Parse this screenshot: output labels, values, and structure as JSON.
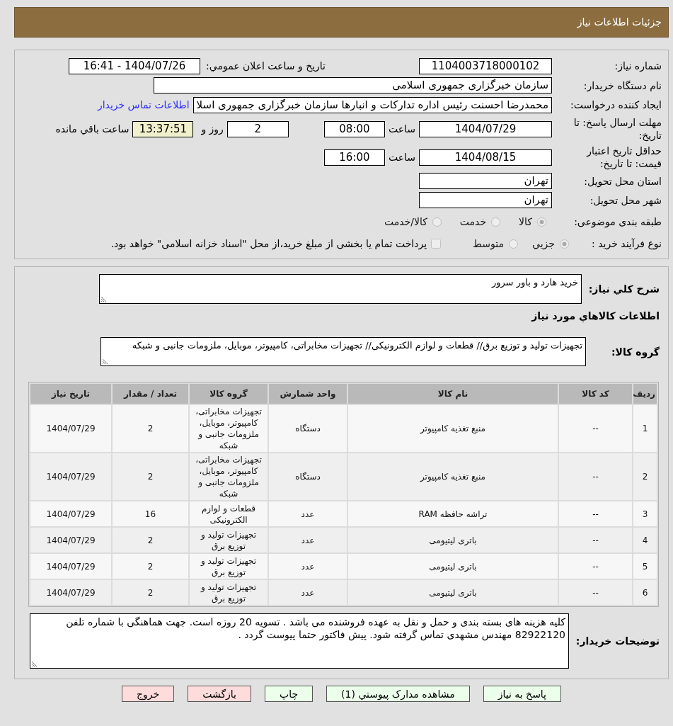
{
  "header": {
    "title": "جزئیات اطلاعات نیاز"
  },
  "details": {
    "need_number": {
      "label": "شماره نیاز:",
      "value": "1104003718000102"
    },
    "announcement": {
      "label": "تاریخ و ساعت اعلان عمومي:",
      "value": "1404/07/26 - 16:41"
    },
    "buyer_org": {
      "label": "نام دستگاه خریدار:",
      "value": "سازمان خبرگزاری جمهوری اسلامی"
    },
    "requester": {
      "label": "ایجاد کننده درخواست:",
      "value": "محمدرضا احسنت رئیس اداره تدارکات و انبارها سازمان خبرگزاری جمهوری اسلا",
      "link": "اطلاعات تماس خریدار"
    },
    "reply_deadline": {
      "label": "مهلت ارسال پاسخ: تا تاریخ:",
      "date": "1404/07/29",
      "time_label": "ساعت",
      "time": "08:00",
      "days": "2",
      "days_label": "روز و",
      "remaining": "13:37:51",
      "remaining_label": "ساعت باقي مانده"
    },
    "price_validity": {
      "label": "حداقل تاریخ اعتبار قیمت: تا تاریخ:",
      "date": "1404/08/15",
      "time_label": "ساعت",
      "time": "16:00"
    },
    "province": {
      "label": "استان محل تحویل:",
      "value": "تهران"
    },
    "city": {
      "label": "شهر محل تحویل:",
      "value": "تهران"
    },
    "category": {
      "label": "طبقه بندی موضوعی:",
      "disabled": true,
      "options": [
        {
          "label": "کالا",
          "selected": true
        },
        {
          "label": "خدمت",
          "selected": false
        },
        {
          "label": "کالا/خدمت",
          "selected": false
        }
      ]
    },
    "process": {
      "label": "نوع فرآیند خرید :",
      "disabled": true,
      "options": [
        {
          "label": "جزيي",
          "selected": true
        },
        {
          "label": "متوسط",
          "selected": false
        }
      ],
      "treasury": {
        "label": "پرداخت تمام یا بخشی از مبلغ خرید،از محل \"اسناد خزانه اسلامی\" خواهد بود.",
        "checked": false,
        "disabled": true
      }
    }
  },
  "need": {
    "summary": {
      "label": "شرح کلي نیاز:",
      "value": "خرید هارد و باور سرور"
    },
    "goods_heading": "اطلاعات کالاهاي مورد نیاز",
    "goods_group": {
      "label": "گروه کالا:",
      "value": "تجهیزات تولید و توزیع برق// قطعات و لوازم الکترونیکی// تجهیزات مخابراتی، کامپیوتر، موبایل، ملزومات جانبی و شبکه"
    },
    "table": {
      "columns": [
        "ردیف",
        "کد کالا",
        "نام کالا",
        "واحد شمارش",
        "گروه کالا",
        "تعداد / مقدار",
        "تاریخ نیاز"
      ],
      "rows": [
        [
          "1",
          "--",
          "منبع تغذیه کامپیوتر",
          "دستگاه",
          "تجهیزات مخابراتی، کامپیوتر، موبایل، ملزومات جانبی و شبکه",
          "2",
          "1404/07/29"
        ],
        [
          "2",
          "--",
          "منبع تغذیه کامپیوتر",
          "دستگاه",
          "تجهیزات مخابراتی، کامپیوتر، موبایل، ملزومات جانبی و شبکه",
          "2",
          "1404/07/29"
        ],
        [
          "3",
          "--",
          "تراشه حافظه RAM",
          "عدد",
          "قطعات و لوازم الکترونیکی",
          "16",
          "1404/07/29"
        ],
        [
          "4",
          "--",
          "باتری لیتیومی",
          "عدد",
          "تجهیزات تولید و توزیع برق",
          "2",
          "1404/07/29"
        ],
        [
          "5",
          "--",
          "باتری لیتیومی",
          "عدد",
          "تجهیزات تولید و توزیع برق",
          "2",
          "1404/07/29"
        ],
        [
          "6",
          "--",
          "باتری لیتیومی",
          "عدد",
          "تجهیزات تولید و توزیع برق",
          "2",
          "1404/07/29"
        ]
      ]
    },
    "buyer_notes": {
      "label": "توضیحات خریدار:",
      "value": "کلیه هزینه های بسته بندی و حمل و نقل به عهده فروشنده می باشد . تسویه 20 روزه است. جهت هماهنگی با شماره تلفن 82922120 مهندس مشهدی تماس گرفته شود. پیش فاکتور حتما پیوست گردد ."
    }
  },
  "buttons": [
    {
      "label": "پاسخ به نیاز",
      "kind": "positive"
    },
    {
      "label": "مشاهده مدارک پیوستي (1)",
      "kind": "positive"
    },
    {
      "label": "چاپ",
      "kind": "positive"
    },
    {
      "label": "بازگشت",
      "kind": "negative"
    },
    {
      "label": "خروج",
      "kind": "negative"
    }
  ]
}
